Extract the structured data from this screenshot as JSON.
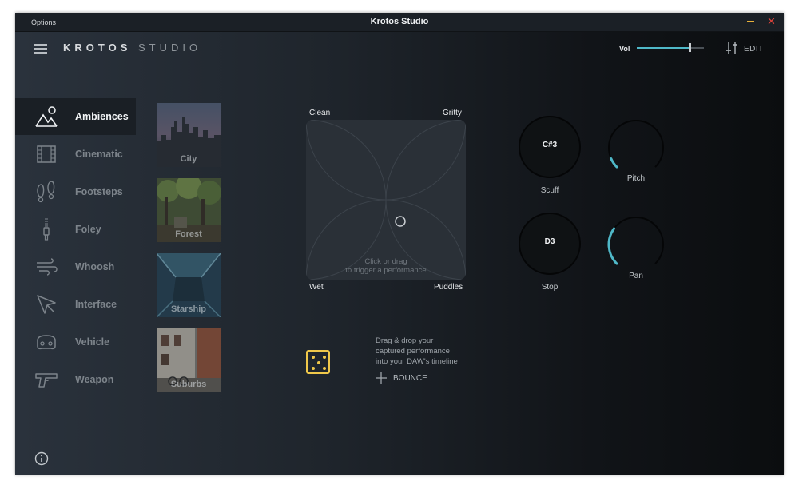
{
  "titlebar": {
    "options_label": "Options",
    "title": "Krotos Studio"
  },
  "header": {
    "brand_bold": "KROTOS",
    "brand_light": "STUDIO",
    "volume_label": "Vol",
    "volume_level": 0.78,
    "edit_label": "EDIT"
  },
  "categories": [
    {
      "label": "Ambiences",
      "icon": "mountains-icon",
      "active": true
    },
    {
      "label": "Cinematic",
      "icon": "film-icon"
    },
    {
      "label": "Footsteps",
      "icon": "footprints-icon"
    },
    {
      "label": "Foley",
      "icon": "zipper-icon"
    },
    {
      "label": "Whoosh",
      "icon": "wind-icon"
    },
    {
      "label": "Interface",
      "icon": "cursor-icon"
    },
    {
      "label": "Vehicle",
      "icon": "car-icon"
    },
    {
      "label": "Weapon",
      "icon": "gun-icon"
    }
  ],
  "presets": [
    {
      "label": "City"
    },
    {
      "label": "Forest"
    },
    {
      "label": "Starship"
    },
    {
      "label": "Suburbs"
    }
  ],
  "xy_pad": {
    "top_left": "Clean",
    "top_right": "Gritty",
    "bottom_left": "Wet",
    "bottom_right": "Puddles",
    "hint_line1": "Click or drag",
    "hint_line2": "to trigger a performance"
  },
  "bounce": {
    "line1": "Drag & drop your",
    "line2": "captured performance",
    "line3": "into your DAW's timeline",
    "label": "BOUNCE"
  },
  "controls": {
    "scuff": {
      "note": "C#3",
      "label": "Scuff"
    },
    "stop": {
      "note": "D3",
      "label": "Stop"
    },
    "pitch": {
      "label": "Pitch",
      "level": 0.08
    },
    "pan": {
      "label": "Pan",
      "level": 0.3
    }
  },
  "colors": {
    "accent": "#4fb8c8",
    "dice": "#f0c84a",
    "close": "#e0443c",
    "minimize": "#e8b13a"
  }
}
